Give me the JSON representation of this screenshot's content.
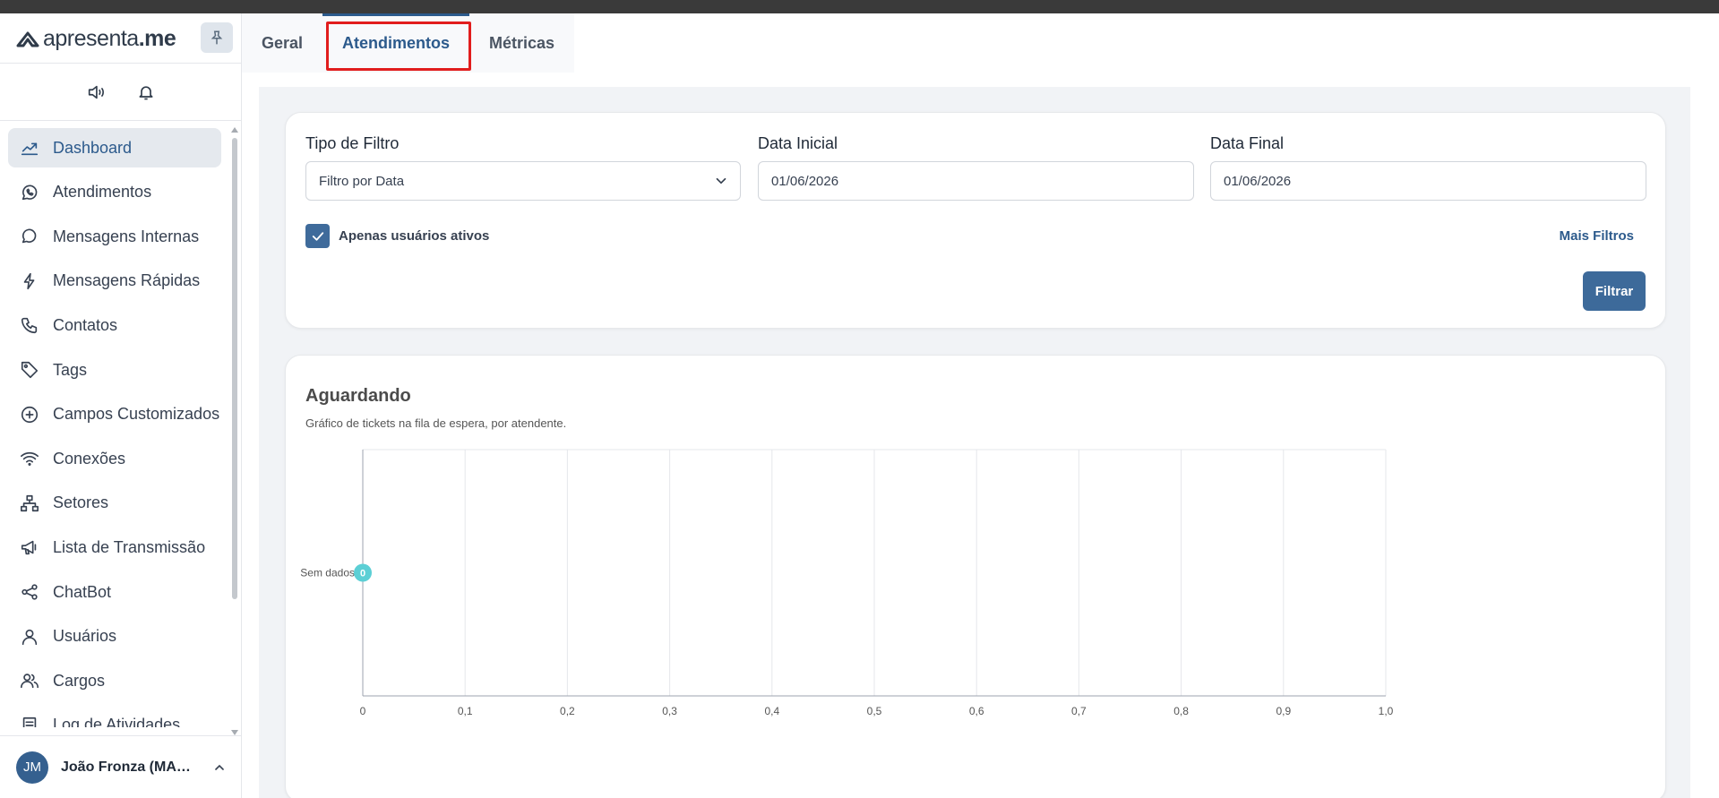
{
  "brand": {
    "logo_light": "apresenta",
    "logo_bold": ".me"
  },
  "sidebar": {
    "items": [
      {
        "label": "Dashboard",
        "icon": "chart-line-icon",
        "active": true
      },
      {
        "label": "Atendimentos",
        "icon": "whatsapp-icon"
      },
      {
        "label": "Mensagens Internas",
        "icon": "chat-bubble-icon"
      },
      {
        "label": "Mensagens Rápidas",
        "icon": "lightning-icon"
      },
      {
        "label": "Contatos",
        "icon": "phone-icon"
      },
      {
        "label": "Tags",
        "icon": "tag-icon"
      },
      {
        "label": "Campos Customizados",
        "icon": "plus-circle-icon"
      },
      {
        "label": "Conexões",
        "icon": "wifi-icon"
      },
      {
        "label": "Setores",
        "icon": "sitemap-icon"
      },
      {
        "label": "Lista de Transmissão",
        "icon": "megaphone-icon"
      },
      {
        "label": "ChatBot",
        "icon": "share-icon"
      },
      {
        "label": "Usuários",
        "icon": "user-icon"
      },
      {
        "label": "Cargos",
        "icon": "users-icon"
      },
      {
        "label": "Log de Atividades",
        "icon": "document-icon"
      }
    ]
  },
  "user": {
    "initials": "JM",
    "name": "João Fronza (MASTER)"
  },
  "tabs": [
    {
      "label": "Geral"
    },
    {
      "label": "Atendimentos",
      "active": true
    },
    {
      "label": "Métricas"
    }
  ],
  "filters": {
    "type_label": "Tipo de Filtro",
    "type_value": "Filtro por Data",
    "start_label": "Data Inicial",
    "start_value": "01/06/2026",
    "end_label": "Data Final",
    "end_value": "01/06/2026",
    "active_only_label": "Apenas usuários ativos",
    "active_only_checked": true,
    "more_filters": "Mais Filtros",
    "submit": "Filtrar"
  },
  "chart_data": {
    "type": "bar",
    "title": "Aguardando",
    "subtitle": "Gráfico de tickets na fila de espera, por atendente.",
    "orientation": "horizontal",
    "categories": [
      "Sem dados"
    ],
    "values": [
      0
    ],
    "xlim": [
      0,
      1
    ],
    "x_ticks": [
      "0",
      "0,1",
      "0,2",
      "0,3",
      "0,4",
      "0,5",
      "0,6",
      "0,7",
      "0,8",
      "0,9",
      "1,0"
    ],
    "grid": true,
    "bar_color": "#5ccfd5"
  },
  "colors": {
    "accent": "#2c5a8c",
    "highlight": "#e11d1d"
  }
}
